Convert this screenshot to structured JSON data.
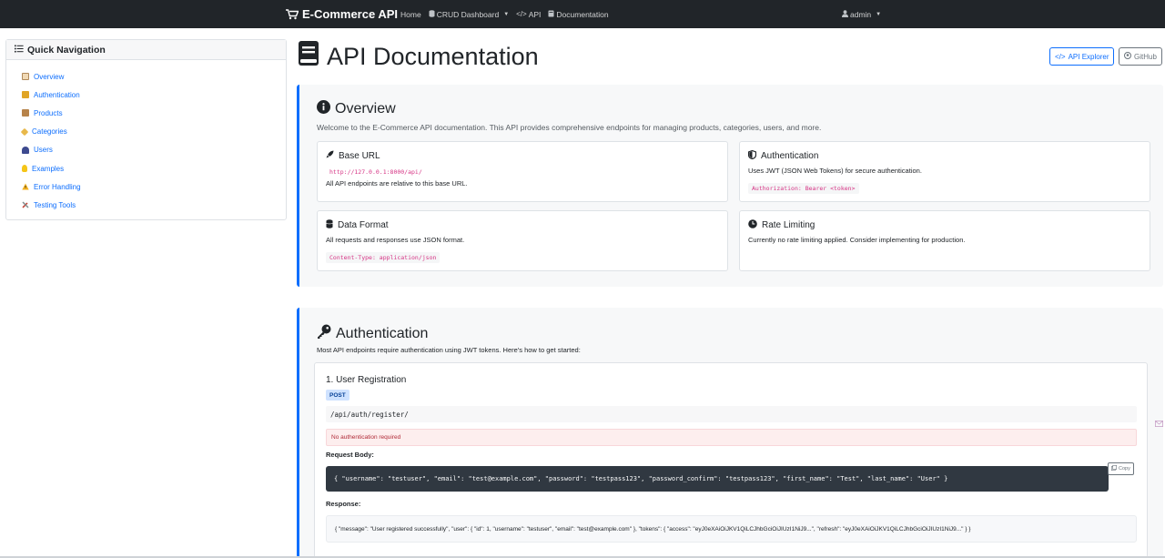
{
  "navbar": {
    "brand": "E-Commerce API",
    "links": [
      {
        "label": "Home"
      },
      {
        "label": "CRUD Dashboard"
      },
      {
        "label": "API"
      },
      {
        "label": "Documentation"
      }
    ],
    "user": "admin"
  },
  "sidebar": {
    "title": "Quick Navigation",
    "items": [
      {
        "label": "Overview",
        "icon": "book-icon"
      },
      {
        "label": "Authentication",
        "icon": "lock-icon"
      },
      {
        "label": "Products",
        "icon": "box-icon"
      },
      {
        "label": "Categories",
        "icon": "tag-icon"
      },
      {
        "label": "Users",
        "icon": "users-icon"
      },
      {
        "label": "Examples",
        "icon": "lightbulb-icon"
      },
      {
        "label": "Error Handling",
        "icon": "warning-icon"
      },
      {
        "label": "Testing Tools",
        "icon": "tools-icon"
      }
    ]
  },
  "page": {
    "title": "API Documentation",
    "api_explorer_label": "API Explorer",
    "github_label": "GitHub"
  },
  "overview": {
    "title": "Overview",
    "description": "Welcome to the E-Commerce API documentation. This API provides comprehensive endpoints for managing products, categories, users, and more.",
    "cards": {
      "base_url": {
        "title": "Base URL",
        "code": "http://127.0.0.1:8000/api/",
        "text": "All API endpoints are relative to this base URL."
      },
      "auth": {
        "title": "Authentication",
        "text": "Uses JWT (JSON Web Tokens) for secure authentication.",
        "code": "Authorization: Bearer <token>"
      },
      "format": {
        "title": "Data Format",
        "text": "All requests and responses use JSON format.",
        "code": "Content-Type: application/json"
      },
      "rate": {
        "title": "Rate Limiting",
        "text": "Currently no rate limiting applied. Consider implementing for production."
      }
    }
  },
  "authentication": {
    "title": "Authentication",
    "description": "Most API endpoints require authentication using JWT tokens. Here's how to get started:",
    "registration": {
      "title": "1. User Registration",
      "method": "POST",
      "path": "/api/auth/register/",
      "alert": "No authentication required",
      "request_label": "Request Body:",
      "request_body": "{ \"username\": \"testuser\", \"email\": \"test@example.com\", \"password\": \"testpass123\", \"password_confirm\": \"testpass123\", \"first_name\": \"Test\", \"last_name\": \"User\" }",
      "copy_label": "Copy",
      "response_label": "Response:",
      "response_body": "{ \"message\": \"User registered successfully\", \"user\": { \"id\": 1, \"username\": \"testuser\", \"email\": \"test@example.com\" }, \"tokens\": { \"access\": \"eyJ0eXAiOiJKV1QiLCJhbGciOiJIUzI1NiJ9...\", \"refresh\": \"eyJ0eXAiOiJKV1QiLCJhbGciOiJIUzI1NiJ9...\" } }"
    }
  },
  "colors": {
    "navbar": "#212529",
    "primary": "#0d6efd",
    "code_pink": "#d63384"
  }
}
